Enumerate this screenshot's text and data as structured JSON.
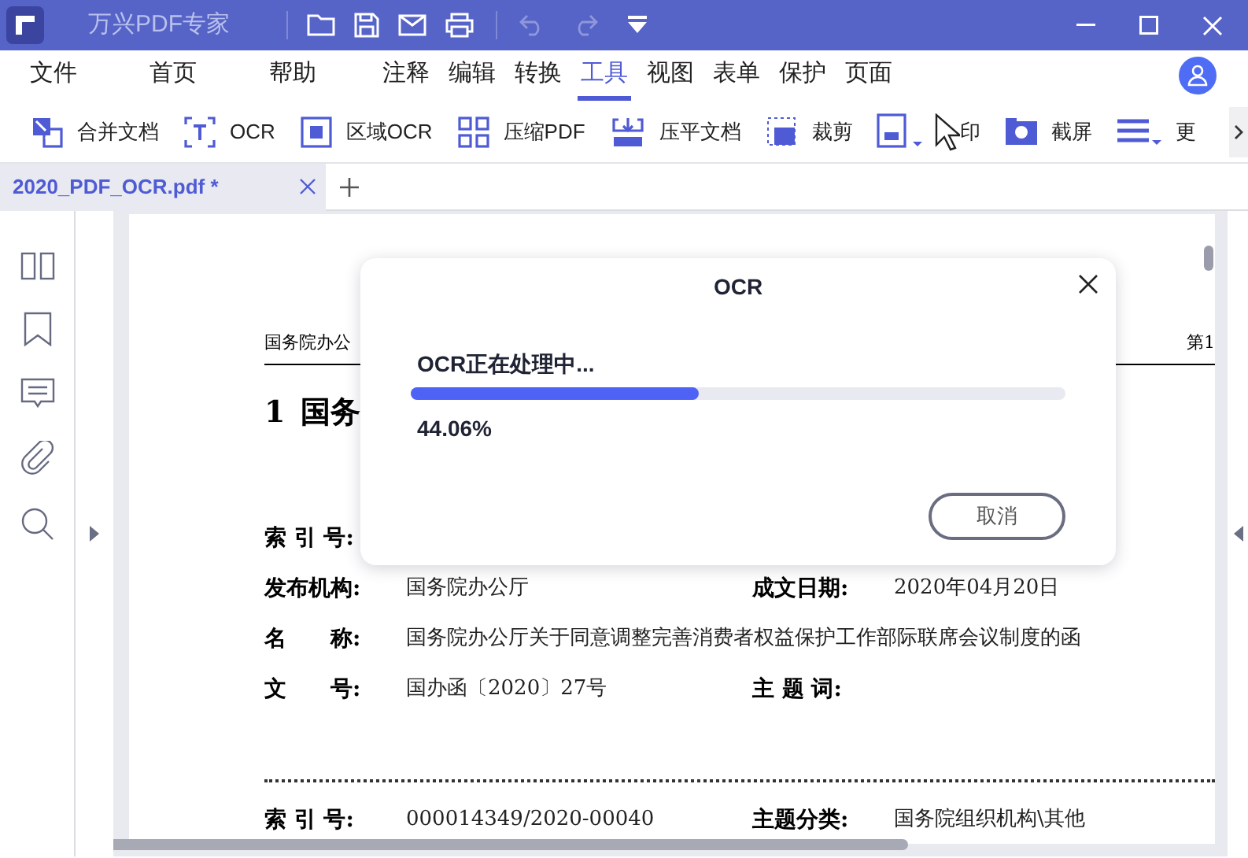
{
  "window": {
    "title": "万兴PDF专家"
  },
  "menu": [
    {
      "label": "文件",
      "selected": false
    },
    {
      "label": "首页",
      "selected": false
    },
    {
      "label": "帮助",
      "selected": false
    },
    {
      "label": "注释",
      "selected": false
    },
    {
      "label": "编辑",
      "selected": false
    },
    {
      "label": "转换",
      "selected": false
    },
    {
      "label": "工具",
      "selected": true
    },
    {
      "label": "视图",
      "selected": false
    },
    {
      "label": "表单",
      "selected": false
    },
    {
      "label": "保护",
      "selected": false
    },
    {
      "label": "页面",
      "selected": false
    }
  ],
  "toolbar": [
    {
      "kind": "merge",
      "label": "合并文档"
    },
    {
      "kind": "ocr",
      "label": "OCR"
    },
    {
      "kind": "area-ocr",
      "label": "区域OCR"
    },
    {
      "kind": "compress",
      "label": "压缩PDF"
    },
    {
      "kind": "flatten",
      "label": "压平文档"
    },
    {
      "kind": "crop",
      "label": "裁剪"
    },
    {
      "kind": "dropdown"
    },
    {
      "kind": "print",
      "label": "印"
    },
    {
      "kind": "screenshot",
      "label": "截屏"
    },
    {
      "kind": "more",
      "label": "更"
    }
  ],
  "tabs": [
    {
      "label": "2020_PDF_OCR.pdf *",
      "selected": true
    }
  ],
  "document": {
    "header_left": "国务院办公",
    "header_right": "第1",
    "heading_number": "1",
    "heading": "国务",
    "rows": [
      {
        "label": "索 引 号:"
      },
      {
        "label": "发布机构:",
        "value": "国务院办公厅",
        "label2": "成文日期:",
        "value2": "2020年04月20日"
      },
      {
        "label": "名　　称:",
        "value": "国务院办公厅关于同意调整完善消费者权益保护工作部际联席会议制度的函"
      },
      {
        "label": "文　　号:",
        "value": "国办函〔2020〕27号",
        "label2": "主 题 词:"
      }
    ],
    "next_row": {
      "label": "索 引 号:",
      "value": "000014349/2020-00040",
      "label2": "主题分类:",
      "value2": "国务院组织机构\\其他"
    }
  },
  "dialog": {
    "title": "OCR",
    "message": "OCR正在处理中...",
    "level": 0.4406,
    "percent": "44.06%",
    "button": "取消"
  }
}
